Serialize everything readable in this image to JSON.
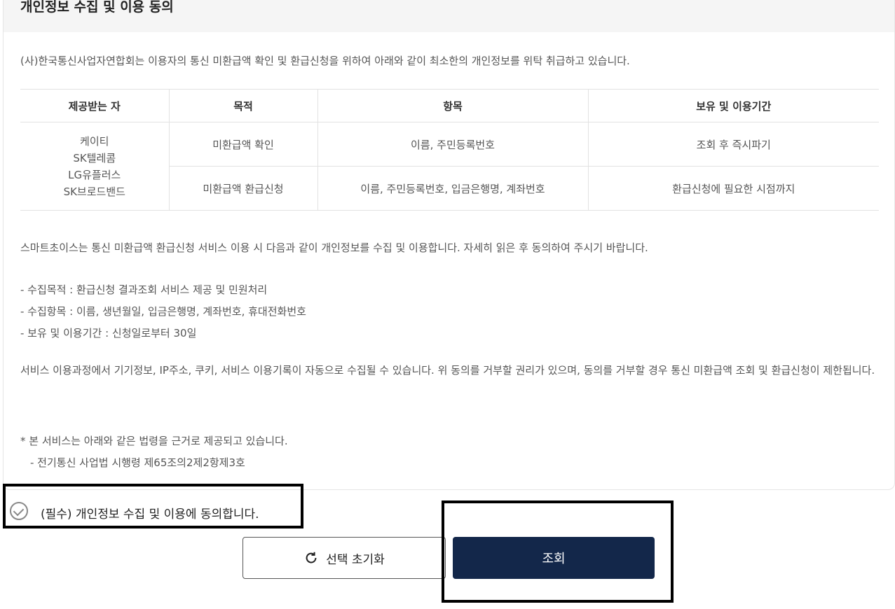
{
  "section": {
    "title": "개인정보 수집 및 이용 동의",
    "intro": "(사)한국통신사업자연합회는 이용자의 통신 미환급액 확인 및 환급신청을 위하여 아래와 같이 최소한의 개인정보를 위탁 취급하고 있습니다."
  },
  "table": {
    "headers": [
      "제공받는 자",
      "목적",
      "항목",
      "보유 및 이용기간"
    ],
    "providers": [
      "케이티",
      "SK텔레콤",
      "LG유플러스",
      "SK브로드밴드"
    ],
    "rows": [
      {
        "purpose": "미환급액 확인",
        "items": "이름, 주민등록번호",
        "period": "조회 후 즉시파기"
      },
      {
        "purpose": "미환급액 환급신청",
        "items": "이름, 주민등록번호, 입금은행명, 계좌번호",
        "period": "환급신청에 필요한 시점까지"
      }
    ]
  },
  "body": {
    "notice": "스마트초이스는 통신 미환급액 환급신청 서비스 이용 시 다음과 같이 개인정보를 수집 및 이용합니다. 자세히 읽은 후 동의하여 주시기 바랍니다.",
    "bullets": [
      "- 수집목적 : 환급신청 결과조회 서비스 제공 및 민원처리",
      "- 수집항목 : 이름, 생년월일, 입금은행명, 계좌번호, 휴대전화번호",
      "- 보유 및 이용기간 : 신청일로부터 30일"
    ],
    "rights": "서비스 이용과정에서 기기정보, IP주소, 쿠키, 서비스 이용기록이 자동으로 수집될 수 있습니다. 위 동의를 거부할 권리가 있으며, 동의를 거부할 경우 통신 미환급액 조회 및 환급신청이 제한됩니다.",
    "law_note": "* 본 서비스는 아래와 같은 법령을 근거로 제공되고 있습니다.",
    "law_item": "- 전기통신 사업법 시행령 제65조의2제2항제3호"
  },
  "agree": {
    "label": "(필수) 개인정보 수집 및 이용에 동의합니다.",
    "checked": false
  },
  "buttons": {
    "reset": "선택 초기화",
    "search": "조회"
  },
  "colors": {
    "primary": "#13274a",
    "header_bg": "#f5f5f5",
    "border": "#e2e2e2"
  }
}
